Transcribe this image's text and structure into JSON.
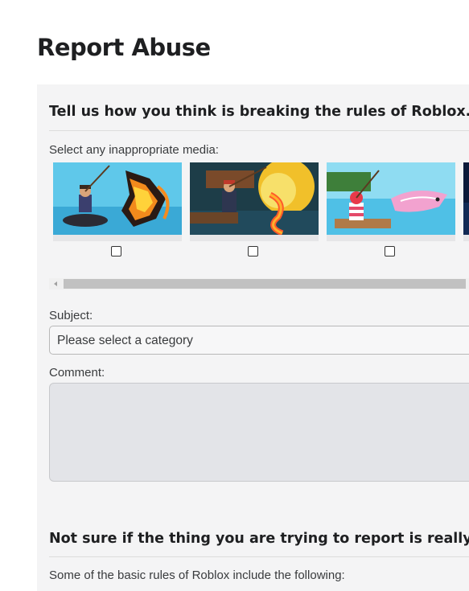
{
  "page": {
    "title": "Report Abuse"
  },
  "report": {
    "heading": "Tell us how you think is breaking the rules of Roblox.",
    "media_label": "Select any inappropriate media:",
    "media": [
      {
        "thumb": "fisher-lava-dragon-thumbnail",
        "checked": false
      },
      {
        "thumb": "fisher-magma-serpent-thumbnail",
        "checked": false
      },
      {
        "thumb": "fisher-pink-shark-thumbnail",
        "checked": false
      },
      {
        "thumb": "dark-thumbnail-partial",
        "checked": false
      }
    ],
    "subject_label": "Subject:",
    "subject_placeholder": "Please select a category",
    "comment_label": "Comment:"
  },
  "rules": {
    "heading": "Not sure if the thing you are trying to report is really ag",
    "intro": "Some of the basic rules of Roblox include the following:"
  },
  "colors": {
    "panel_bg": "#f4f4f5",
    "title_text": "#1e1f21",
    "comment_bg": "#e3e4e8"
  }
}
